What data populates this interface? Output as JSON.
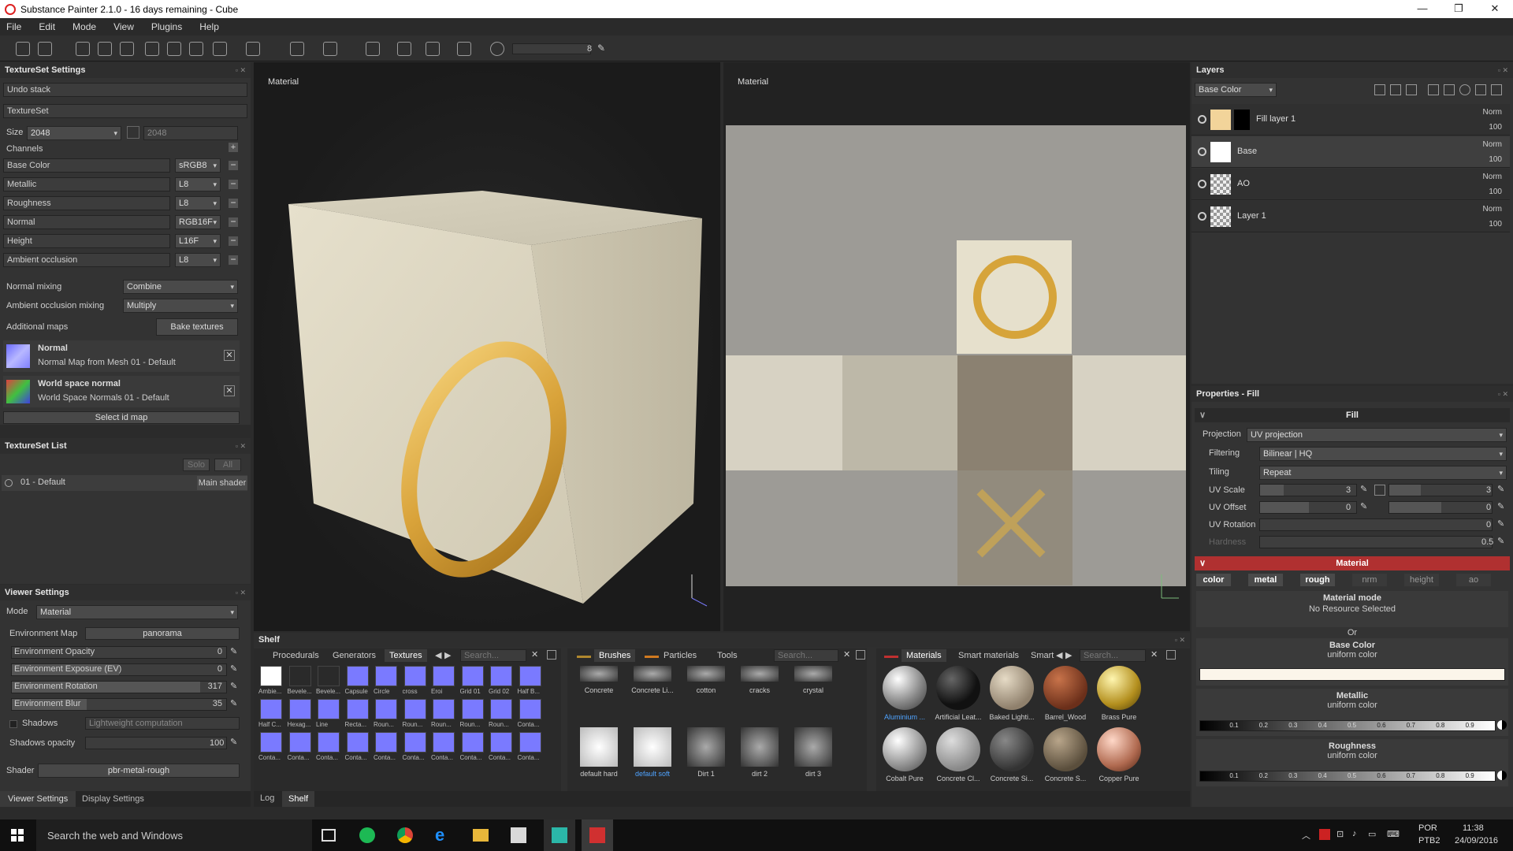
{
  "window": {
    "title": "Substance Painter 2.1.0 - 16 days remaining - Cube",
    "controls": [
      "—",
      "❐",
      "✕"
    ]
  },
  "menu": [
    "File",
    "Edit",
    "Mode",
    "View",
    "Plugins",
    "Help"
  ],
  "toolbar": {
    "brush_size": "8"
  },
  "textureset_settings": {
    "title": "TextureSet Settings",
    "undo_stack": "Undo stack",
    "textureset": "TextureSet",
    "size_label": "Size",
    "size_value": "2048",
    "size_value2": "2048",
    "channels_label": "Channels",
    "channels": [
      {
        "name": "Base Color",
        "format": "sRGB8"
      },
      {
        "name": "Metallic",
        "format": "L8"
      },
      {
        "name": "Roughness",
        "format": "L8"
      },
      {
        "name": "Normal",
        "format": "RGB16F"
      },
      {
        "name": "Height",
        "format": "L16F"
      },
      {
        "name": "Ambient occlusion",
        "format": "L8"
      }
    ],
    "normal_mixing_label": "Normal mixing",
    "normal_mixing_value": "Combine",
    "ao_mixing_label": "Ambient occlusion mixing",
    "ao_mixing_value": "Multiply",
    "additional_maps_label": "Additional maps",
    "bake_button": "Bake textures",
    "maps": [
      {
        "title": "Normal",
        "subtitle": "Normal Map from Mesh 01 - Default"
      },
      {
        "title": "World space normal",
        "subtitle": "World Space Normals 01 - Default"
      }
    ],
    "select_id_map": "Select id map"
  },
  "textureset_list": {
    "title": "TextureSet List",
    "solo": "Solo",
    "all": "All",
    "item": "01 - Default",
    "shader": "Main shader"
  },
  "viewer_settings": {
    "title": "Viewer Settings",
    "mode_label": "Mode",
    "mode_value": "Material",
    "env_map_label": "Environment Map",
    "env_map_value": "panorama",
    "rows": [
      {
        "label": "Environment Opacity",
        "value": "0",
        "level": 0
      },
      {
        "label": "Environment Exposure (EV)",
        "value": "0",
        "level": 0.5
      },
      {
        "label": "Environment Rotation",
        "value": "317",
        "level": 0.88
      },
      {
        "label": "Environment Blur",
        "value": "35",
        "level": 0.35
      }
    ],
    "shadows_label": "Shadows",
    "shadows_value": "Lightweight computation",
    "shadows_opacity_label": "Shadows opacity",
    "shadows_opacity_value": "100",
    "shader_label": "Shader",
    "shader_value": "pbr-metal-rough",
    "bottom_tabs": [
      "Viewer Settings",
      "Display Settings"
    ]
  },
  "viewport_3d": {
    "label": "Material"
  },
  "viewport_2d": {
    "label": "Material"
  },
  "layers": {
    "title": "Layers",
    "channel": "Base Color",
    "items": [
      {
        "name": "Fill layer 1",
        "blend": "Norm",
        "opacity": "100"
      },
      {
        "name": "Base",
        "blend": "Norm",
        "opacity": "100"
      },
      {
        "name": "AO",
        "blend": "Norm",
        "opacity": "100"
      },
      {
        "name": "Layer 1",
        "blend": "Norm",
        "opacity": "100"
      }
    ]
  },
  "properties": {
    "title": "Properties - Fill",
    "fill_header": "Fill",
    "projection_label": "Projection",
    "projection_value": "UV projection",
    "filtering_label": "Filtering",
    "filtering_value": "Bilinear | HQ",
    "tiling_label": "Tiling",
    "tiling_value": "Repeat",
    "uv_scale_label": "UV Scale",
    "uv_scale_values": [
      "3",
      "3"
    ],
    "uv_offset_label": "UV Offset",
    "uv_offset_values": [
      "0",
      "0"
    ],
    "uv_rotation_label": "UV Rotation",
    "uv_rotation_value": "0",
    "hardness_label": "Hardness",
    "hardness_value": "0.5",
    "material_header": "Material",
    "channel_tabs": [
      "color",
      "metal",
      "rough",
      "nrm",
      "height",
      "ao"
    ],
    "material_mode_title": "Material mode",
    "material_mode_value": "No Resource Selected",
    "or_text": "Or",
    "base_color_title": "Base Color",
    "base_color_sub": "uniform color",
    "base_color_hex": "#fbf5ea",
    "metallic_title": "Metallic",
    "metallic_sub": "uniform color",
    "roughness_title": "Roughness",
    "roughness_sub": "uniform color",
    "scale_ticks": [
      "0.1",
      "0.2",
      "0.3",
      "0.4",
      "0.5",
      "0.6",
      "0.7",
      "0.8",
      "0.9"
    ]
  },
  "shelf": {
    "title": "Shelf",
    "tabs_left": [
      "Procedurals",
      "Generators",
      "Textures"
    ],
    "search_placeholder": "Search...",
    "texture_labels_row1": [
      "Ambie...",
      "Bevele...",
      "Bevele...",
      "Capsule",
      "Circle",
      "cross",
      "Eroi",
      "Grid 01",
      "Grid 02",
      "Half B..."
    ],
    "texture_labels_row2": [
      "Half C...",
      "Hexag...",
      "Line",
      "Recta...",
      "Roun...",
      "Roun...",
      "Roun...",
      "Roun...",
      "Roun...",
      "Conta..."
    ],
    "texture_labels_row3": [
      "Conta...",
      "Conta...",
      "Conta...",
      "Conta...",
      "Conta...",
      "Conta...",
      "Conta...",
      "Conta...",
      "Conta...",
      "Conta..."
    ],
    "brush_tabs": [
      "Brushes",
      "Particles",
      "Tools"
    ],
    "brush_labels_row1": [
      "Concrete",
      "Concrete Li...",
      "cotton",
      "cracks",
      "crystal"
    ],
    "brush_labels_row2": [
      "default hard",
      "default soft",
      "Dirt 1",
      "dirt 2",
      "dirt 3"
    ],
    "material_tabs": [
      "Materials",
      "Smart materials",
      "Smart"
    ],
    "material_labels_row1": [
      "Aluminium ...",
      "Artificial Leat...",
      "Baked Lighti...",
      "Barrel_Wood",
      "Brass Pure"
    ],
    "material_labels_row2": [
      "Cobalt Pure",
      "Concrete Cl...",
      "Concrete Si...",
      "Concrete S...",
      "Copper Pure"
    ],
    "bottom_tabs": [
      "Log",
      "Shelf"
    ]
  },
  "taskbar": {
    "search_placeholder": "Search the web and Windows",
    "lang": "POR",
    "layout": "PTB2",
    "time": "11:38",
    "date": "24/09/2016"
  }
}
